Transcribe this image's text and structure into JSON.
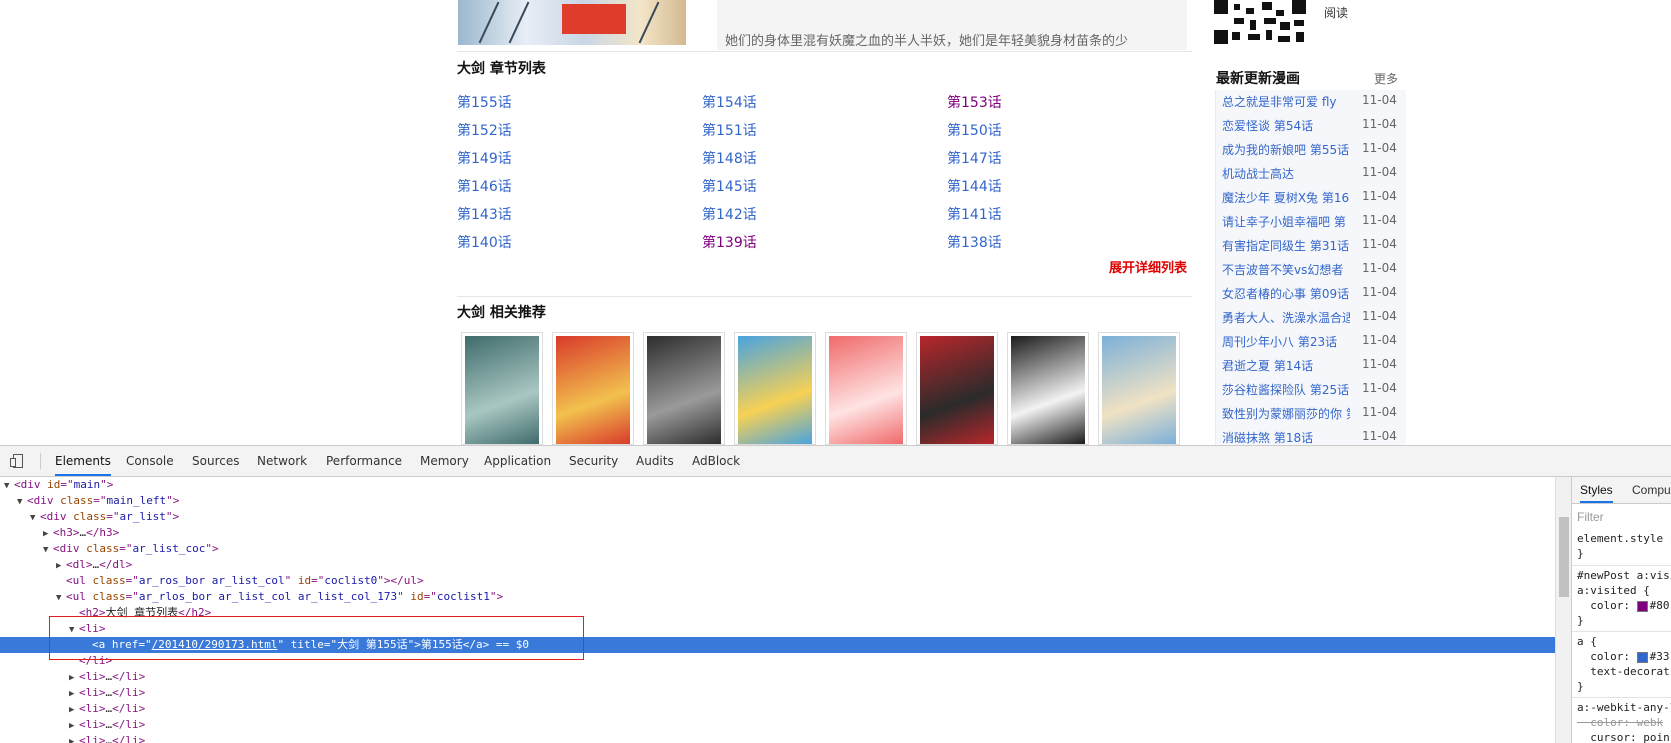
{
  "page": {
    "top_description": "她们的身体里混有妖魔之血的半人半妖，她们是年轻美貌身材苗条的少",
    "qr_label": "阅读",
    "chapter_section_title": "大剑 章节列表",
    "chapters": [
      {
        "label": "第155话",
        "visited": false
      },
      {
        "label": "第154话",
        "visited": false
      },
      {
        "label": "第153话",
        "visited": true
      },
      {
        "label": "第152话",
        "visited": false
      },
      {
        "label": "第151话",
        "visited": false
      },
      {
        "label": "第150话",
        "visited": false
      },
      {
        "label": "第149话",
        "visited": false
      },
      {
        "label": "第148话",
        "visited": false
      },
      {
        "label": "第147话",
        "visited": false
      },
      {
        "label": "第146话",
        "visited": false
      },
      {
        "label": "第145话",
        "visited": false
      },
      {
        "label": "第144话",
        "visited": false
      },
      {
        "label": "第143话",
        "visited": false
      },
      {
        "label": "第142话",
        "visited": false
      },
      {
        "label": "第141话",
        "visited": false
      },
      {
        "label": "第140话",
        "visited": false
      },
      {
        "label": "第139话",
        "visited": true
      },
      {
        "label": "第138话",
        "visited": false
      }
    ],
    "expand_label": "展开详细列表",
    "related_section_title": "大剑 相关推荐",
    "thumbnails": [
      {
        "colors": [
          "#3f6b6b",
          "#a9c7c2"
        ],
        "tag": ""
      },
      {
        "colors": [
          "#d93a2b",
          "#f2c14e"
        ],
        "tag": ""
      },
      {
        "colors": [
          "#2d2d2d",
          "#9a9a9a"
        ],
        "tag": ""
      },
      {
        "colors": [
          "#4aa3df",
          "#f7d154"
        ],
        "tag": ""
      },
      {
        "colors": [
          "#f06a6a",
          "#ffe3e3"
        ],
        "tag": ""
      },
      {
        "colors": [
          "#b8262b",
          "#2b2b2b"
        ],
        "tag": ""
      },
      {
        "colors": [
          "#1b1b1b",
          "#f3f3f3"
        ],
        "tag": ""
      },
      {
        "colors": [
          "#7bb0d9",
          "#f0e2c4"
        ],
        "tag": ""
      }
    ],
    "sidebar": {
      "title": "最新更新漫画",
      "more": "更多",
      "items": [
        {
          "title": "总之就是非常可爱 fly",
          "date": "11-04"
        },
        {
          "title": "恋爱怪谈 第54话",
          "date": "11-04"
        },
        {
          "title": "成为我的新娘吧 第55话",
          "date": "11-04"
        },
        {
          "title": "机动战士高达",
          "date": "11-04"
        },
        {
          "title": "魔法少年 夏树X兔 第16",
          "date": "11-04"
        },
        {
          "title": "请让幸子小姐幸福吧 第",
          "date": "11-04"
        },
        {
          "title": "有害指定同级生 第31话",
          "date": "11-04"
        },
        {
          "title": "不吉波普不笑vs幻想者",
          "date": "11-04"
        },
        {
          "title": "女忍者椿的心事 第09话",
          "date": "11-04"
        },
        {
          "title": "勇者大人、洗澡水温合适",
          "date": "11-04"
        },
        {
          "title": "周刊少年小八 第23话",
          "date": "11-04"
        },
        {
          "title": "君逝之夏 第14话",
          "date": "11-04"
        },
        {
          "title": "莎谷粒酱探险队 第25话",
          "date": "11-04"
        },
        {
          "title": "致性别为蒙娜丽莎的你 第",
          "date": "11-04"
        },
        {
          "title": "消磁抹煞 第18话",
          "date": "11-04"
        }
      ]
    }
  },
  "devtools": {
    "tabs": [
      "Elements",
      "Console",
      "Sources",
      "Network",
      "Performance",
      "Memory",
      "Application",
      "Security",
      "Audits",
      "AdBlock"
    ],
    "active_tab": "Elements",
    "dom": [
      {
        "indent": 0,
        "tw": "▼",
        "parts": [
          [
            "tg",
            "<div "
          ],
          [
            "an",
            "id"
          ],
          [
            "tg",
            "=\""
          ],
          [
            "av",
            "main"
          ],
          [
            "tg",
            "\">"
          ]
        ]
      },
      {
        "indent": 1,
        "tw": "▼",
        "parts": [
          [
            "tg",
            "<div "
          ],
          [
            "an",
            "class"
          ],
          [
            "tg",
            "=\""
          ],
          [
            "av",
            "main_left"
          ],
          [
            "tg",
            "\">"
          ]
        ]
      },
      {
        "indent": 2,
        "tw": "▼",
        "parts": [
          [
            "tg",
            "<div "
          ],
          [
            "an",
            "class"
          ],
          [
            "tg",
            "=\""
          ],
          [
            "av",
            "ar_list"
          ],
          [
            "tg",
            "\">"
          ]
        ]
      },
      {
        "indent": 3,
        "tw": "▶",
        "parts": [
          [
            "tg",
            "<h3>"
          ],
          [
            "tx",
            "…"
          ],
          [
            "tg",
            "</h3>"
          ]
        ]
      },
      {
        "indent": 3,
        "tw": "▼",
        "parts": [
          [
            "tg",
            "<div "
          ],
          [
            "an",
            "class"
          ],
          [
            "tg",
            "=\""
          ],
          [
            "av",
            "ar_list_coc"
          ],
          [
            "tg",
            "\">"
          ]
        ]
      },
      {
        "indent": 4,
        "tw": "▶",
        "parts": [
          [
            "tg",
            "<dl>"
          ],
          [
            "tx",
            "…"
          ],
          [
            "tg",
            "</dl>"
          ]
        ]
      },
      {
        "indent": 4,
        "tw": " ",
        "parts": [
          [
            "tg",
            "<ul "
          ],
          [
            "an",
            "class"
          ],
          [
            "tg",
            "=\""
          ],
          [
            "av",
            "ar_ros_bor ar_list_col"
          ],
          [
            "tg",
            "\" "
          ],
          [
            "an",
            "id"
          ],
          [
            "tg",
            "=\""
          ],
          [
            "av",
            "coclist0"
          ],
          [
            "tg",
            "\"></ul>"
          ]
        ]
      },
      {
        "indent": 4,
        "tw": "▼",
        "parts": [
          [
            "tg",
            "<ul "
          ],
          [
            "an",
            "class"
          ],
          [
            "tg",
            "=\""
          ],
          [
            "av",
            "ar_rlos_bor ar_list_col ar_list_col_173"
          ],
          [
            "tg",
            "\" "
          ],
          [
            "an",
            "id"
          ],
          [
            "tg",
            "=\""
          ],
          [
            "av",
            "coclist1"
          ],
          [
            "tg",
            "\">"
          ]
        ]
      },
      {
        "indent": 5,
        "tw": " ",
        "parts": [
          [
            "tg",
            "<h2>"
          ],
          [
            "tx",
            "大剑 章节列表"
          ],
          [
            "tg",
            "</h2>"
          ]
        ]
      },
      {
        "indent": 5,
        "tw": "▼",
        "parts": [
          [
            "tg",
            "<li>"
          ]
        ]
      },
      {
        "indent": 6,
        "tw": " ",
        "sel": true,
        "parts": [
          [
            "tg",
            "<a "
          ],
          [
            "an",
            "href"
          ],
          [
            "tg",
            "=\""
          ],
          [
            "av link",
            "/201410/290173.html"
          ],
          [
            "tg",
            "\" "
          ],
          [
            "an",
            "title"
          ],
          [
            "tg",
            "=\""
          ],
          [
            "av",
            "大剑 第155话"
          ],
          [
            "tg",
            "\">"
          ],
          [
            "tx",
            "第155话"
          ],
          [
            "tg",
            "</a>"
          ],
          [
            "cm",
            " == $0"
          ]
        ]
      },
      {
        "indent": 5,
        "tw": " ",
        "parts": [
          [
            "tg",
            "</li>"
          ]
        ]
      },
      {
        "indent": 5,
        "tw": "▶",
        "parts": [
          [
            "tg",
            "<li>"
          ],
          [
            "tx",
            "…"
          ],
          [
            "tg",
            "</li>"
          ]
        ]
      },
      {
        "indent": 5,
        "tw": "▶",
        "parts": [
          [
            "tg",
            "<li>"
          ],
          [
            "tx",
            "…"
          ],
          [
            "tg",
            "</li>"
          ]
        ]
      },
      {
        "indent": 5,
        "tw": "▶",
        "parts": [
          [
            "tg",
            "<li>"
          ],
          [
            "tx",
            "…"
          ],
          [
            "tg",
            "</li>"
          ]
        ]
      },
      {
        "indent": 5,
        "tw": "▶",
        "parts": [
          [
            "tg",
            "<li>"
          ],
          [
            "tx",
            "…"
          ],
          [
            "tg",
            "</li>"
          ]
        ]
      },
      {
        "indent": 5,
        "tw": "▶",
        "parts": [
          [
            "tg",
            "<li>"
          ],
          [
            "tx",
            "…"
          ],
          [
            "tg",
            "</li>"
          ]
        ]
      }
    ],
    "styles_panel": {
      "tabs": [
        "Styles",
        "Comput"
      ],
      "filter_placeholder": "Filter",
      "rules": [
        {
          "text": "element.style {"
        },
        {
          "text": "}"
        },
        {
          "text": "#newPost a:visi"
        },
        {
          "text": "a:visited {"
        },
        {
          "text": "  color: ",
          "swatch": "#800080",
          "value": "#80"
        },
        {
          "text": "}"
        },
        {
          "text": "a {"
        },
        {
          "text": "  color: ",
          "swatch": "#3366cc",
          "value": "#33"
        },
        {
          "text": "  text-decorat"
        },
        {
          "text": "}"
        },
        {
          "text": "a:-webkit-any-l"
        },
        {
          "text": "  color: webk",
          "strike": true
        },
        {
          "text": "  cursor: poin"
        }
      ]
    }
  }
}
